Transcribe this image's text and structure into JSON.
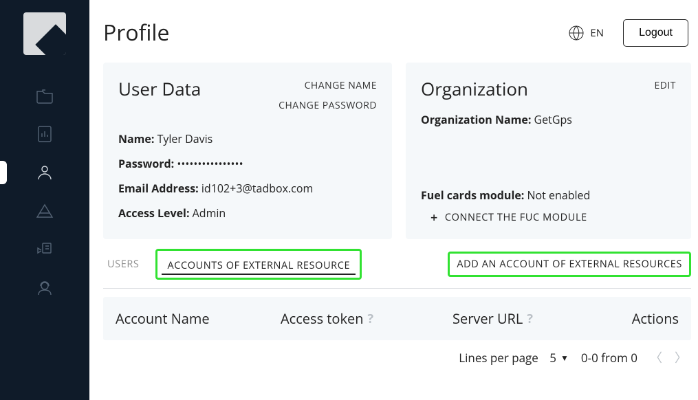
{
  "page_title": "Profile",
  "lang": "EN",
  "logout": "Logout",
  "user_card": {
    "title": "User Data",
    "change_name": "CHANGE NAME",
    "change_password": "CHANGE PASSWORD",
    "name_label": "Name:",
    "name_value": "Tyler Davis",
    "password_label": "Password:",
    "password_value": "••••••••••••••••",
    "email_label": "Email Address:",
    "email_value": "id102+3@tadbox.com",
    "access_label": "Access Level:",
    "access_value": "Admin"
  },
  "org_card": {
    "title": "Organization",
    "edit": "EDIT",
    "org_name_label": "Organization Name:",
    "org_name_value": "GetGps",
    "fuel_label": "Fuel cards module:",
    "fuel_value": "Not enabled",
    "connect_fuc": "CONNECT THE FUC MODULE"
  },
  "tabs": {
    "users": "USERS",
    "accounts_ext": "ACCOUNTS OF EXTERNAL RESOURCE"
  },
  "add_ext": "ADD AN ACCOUNT OF EXTERNAL RESOURCES",
  "table": {
    "account_name": "Account Name",
    "access_token": "Access token",
    "server_url": "Server URL",
    "actions": "Actions"
  },
  "pagination": {
    "lines_per_page": "Lines per page",
    "per_page": "5",
    "range": "0-0 from 0"
  }
}
